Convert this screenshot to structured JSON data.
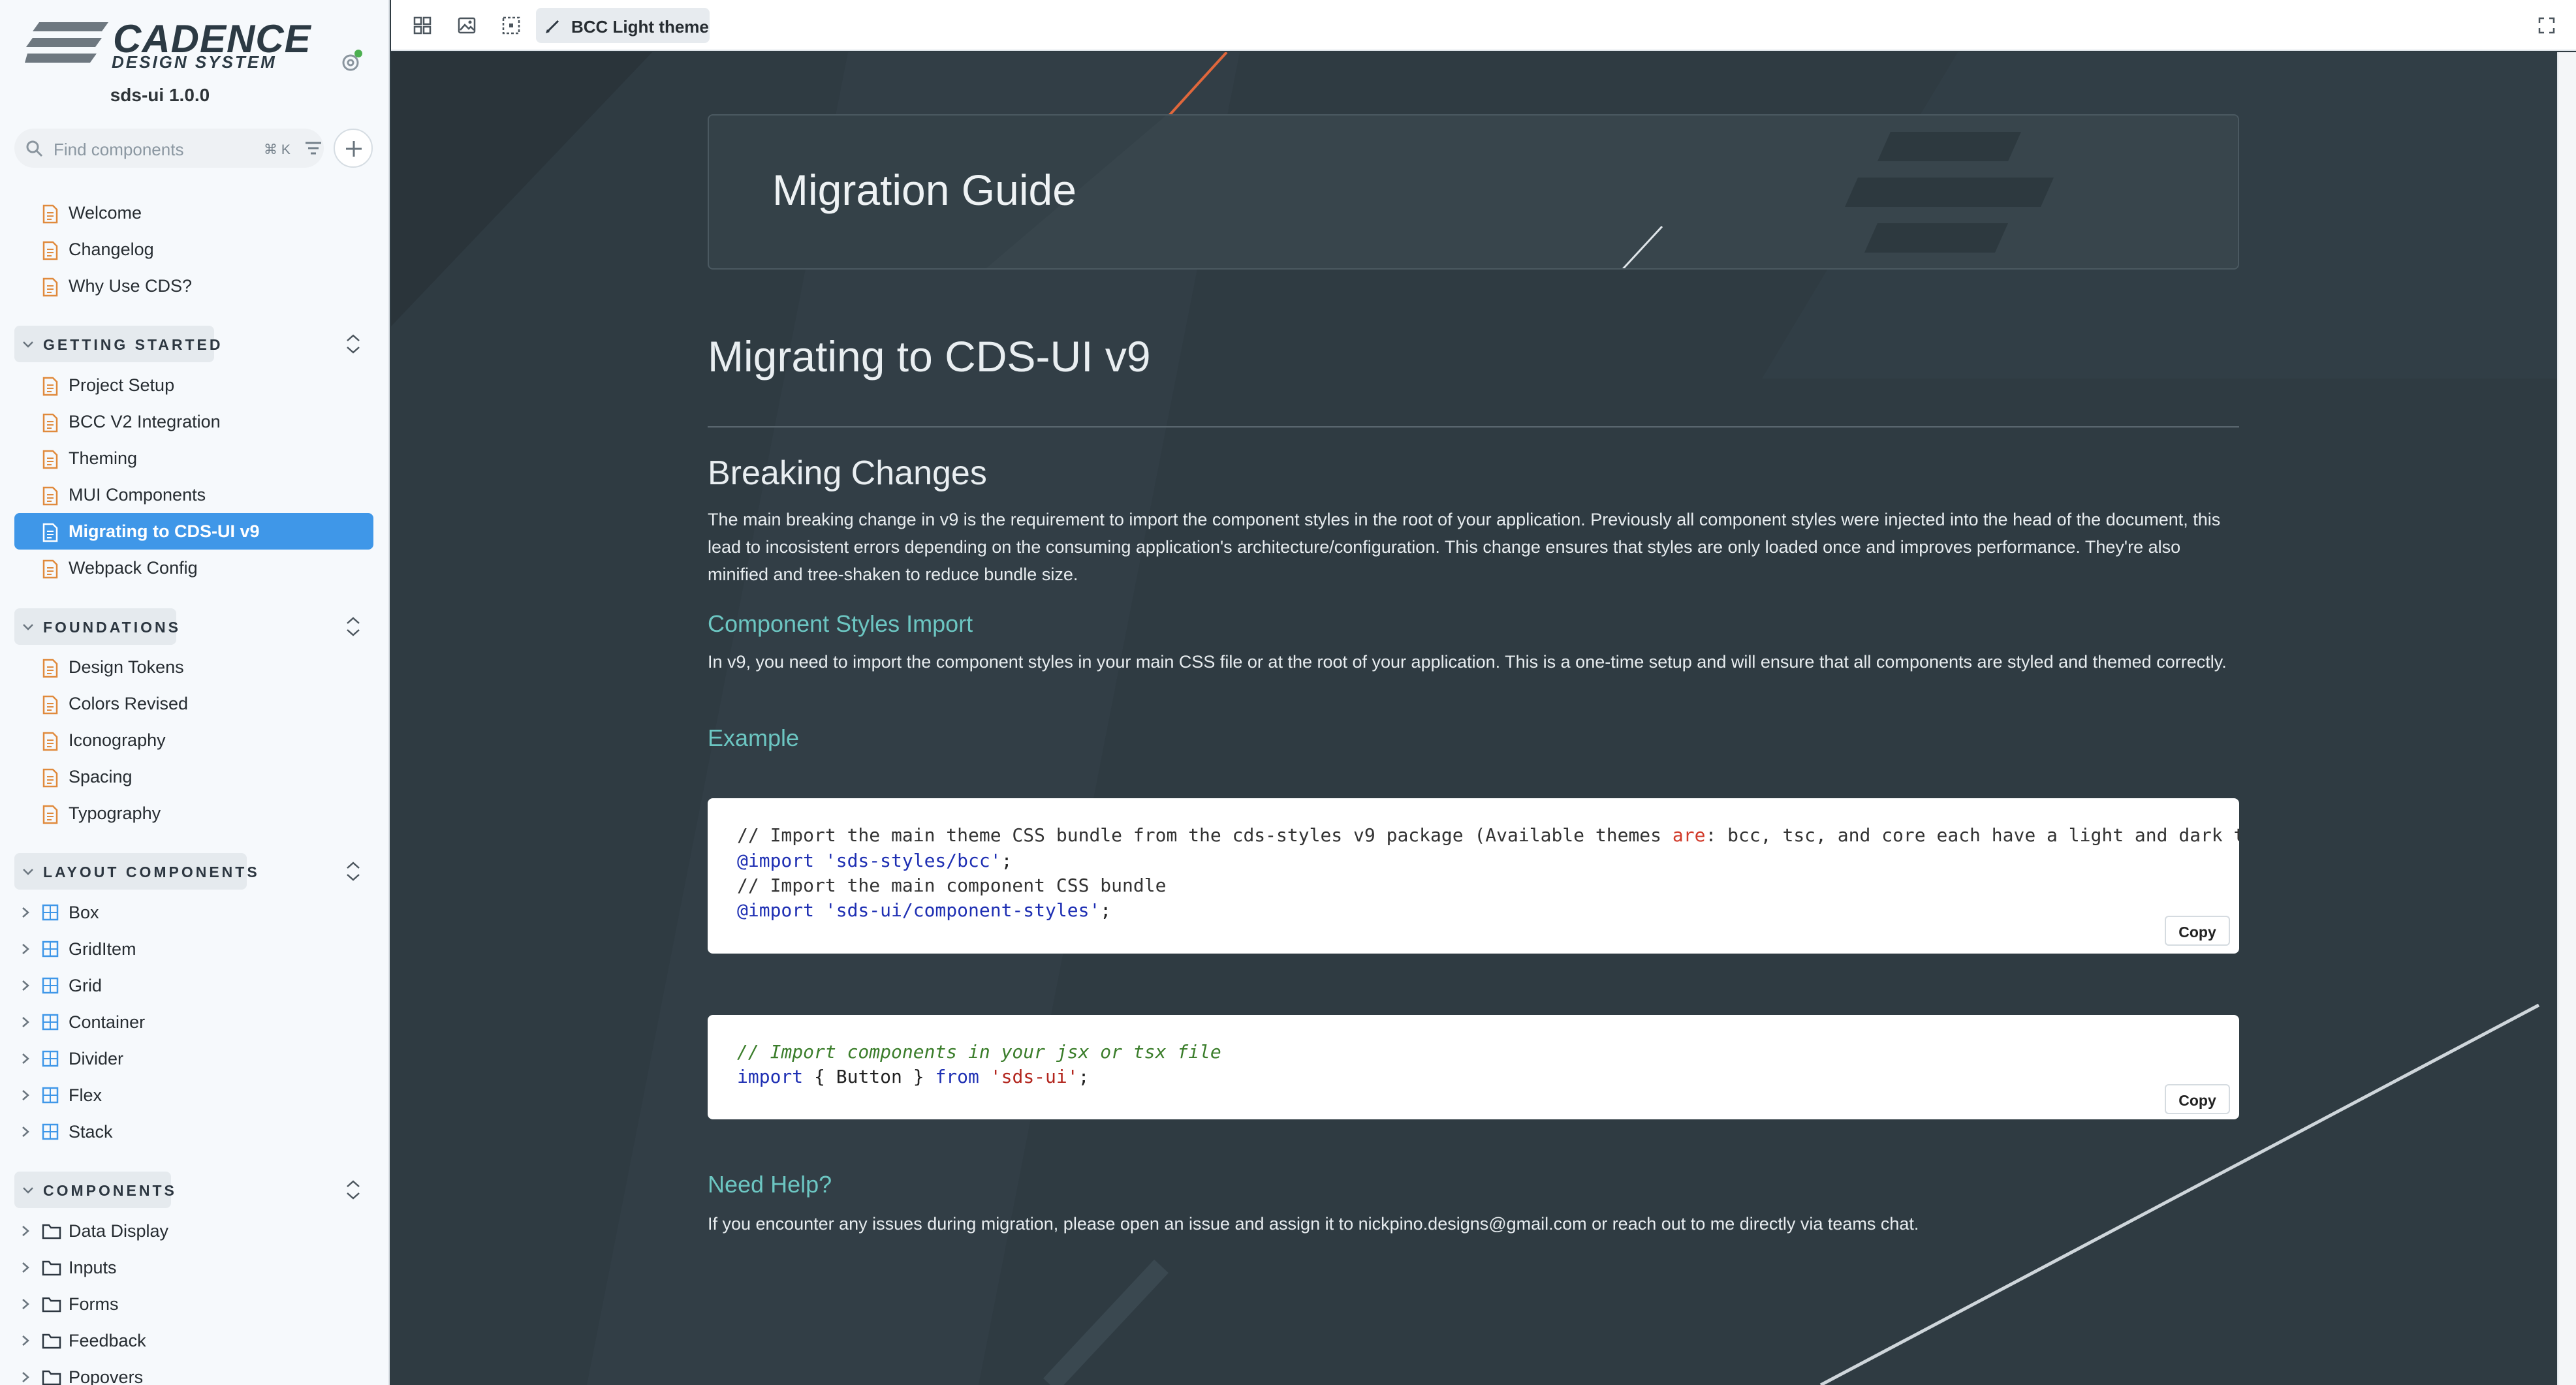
{
  "brand": {
    "name": "CADENCE",
    "subtitle": "DESIGN SYSTEM",
    "version": "sds-ui 1.0.0"
  },
  "search": {
    "placeholder": "Find components",
    "shortcut": "⌘ K"
  },
  "sidebar": {
    "top_items": [
      {
        "label": "Welcome",
        "icon": "document-icon"
      },
      {
        "label": "Changelog",
        "icon": "document-icon"
      },
      {
        "label": "Why Use CDS?",
        "icon": "document-icon"
      }
    ],
    "sections": [
      {
        "label": "GETTING STARTED",
        "items": [
          {
            "label": "Project Setup"
          },
          {
            "label": "BCC V2 Integration"
          },
          {
            "label": "Theming"
          },
          {
            "label": "MUI Components"
          },
          {
            "label": "Migrating to CDS-UI v9",
            "active": true
          },
          {
            "label": "Webpack Config"
          }
        ]
      },
      {
        "label": "FOUNDATIONS",
        "items": [
          {
            "label": "Design Tokens"
          },
          {
            "label": "Colors Revised"
          },
          {
            "label": "Iconography"
          },
          {
            "label": "Spacing"
          },
          {
            "label": "Typography"
          }
        ]
      },
      {
        "label": "LAYOUT COMPONENTS",
        "items": [
          {
            "label": "Box"
          },
          {
            "label": "GridItem"
          },
          {
            "label": "Grid"
          },
          {
            "label": "Container"
          },
          {
            "label": "Divider"
          },
          {
            "label": "Flex"
          },
          {
            "label": "Stack"
          }
        ]
      },
      {
        "label": "COMPONENTS",
        "items": [
          {
            "label": "Data Display"
          },
          {
            "label": "Inputs"
          },
          {
            "label": "Forms"
          },
          {
            "label": "Feedback"
          },
          {
            "label": "Popovers"
          }
        ]
      }
    ]
  },
  "toolbar": {
    "theme_label": "BCC Light theme"
  },
  "content": {
    "hero_title": "Migration Guide",
    "title": "Migrating to CDS-UI v9",
    "breaking_heading": "Breaking Changes",
    "breaking_text": "The main breaking change in v9 is the requirement to import the component styles in the root of your application. Previously all component styles were injected into the head of the document, this lead to incosistent errors depending on the consuming application's architecture/configuration. This change ensures that styles are only loaded once and improves performance. They're also minified and tree-shaken to reduce bundle size.",
    "styles_import_heading": "Component Styles Import",
    "styles_import_text": "In v9, you need to import the component styles in your main CSS file or at the root of your application. This is a one-time setup and will ensure that all components are styled and themed correctly.",
    "example_heading": "Example",
    "code1": {
      "line1_a": "// Import the main theme CSS bundle from the cds-styles v9 package (Available themes ",
      "line1_b": "are",
      "line1_c": ": bcc, tsc, and core each have a light and dark t",
      "line2": "@import 'sds-styles/bcc'",
      "line2_end": ";",
      "line3": "// Import the main component CSS bundle",
      "line4": "@import 'sds-ui/component-styles'",
      "line4_end": ";"
    },
    "code2": {
      "line1": "// Import components in your jsx or tsx file",
      "line2_kw1": "import",
      "line2_mid": " { Button } ",
      "line2_kw2": "from",
      "line2_str": " 'sds-ui'",
      "line2_end": ";"
    },
    "copy_label": "Copy",
    "help_heading": "Need Help?",
    "help_text": "If you encounter any issues during migration, please open an issue and assign it to nickpino.designs@gmail.com or reach out to me directly via teams chat."
  },
  "colors": {
    "accent": "#3f97e8",
    "heading_teal": "#6cc6c2",
    "content_bg": "#2f3b42",
    "sidebar_bg": "#f6f9fc",
    "status_dot": "#4caf50"
  }
}
